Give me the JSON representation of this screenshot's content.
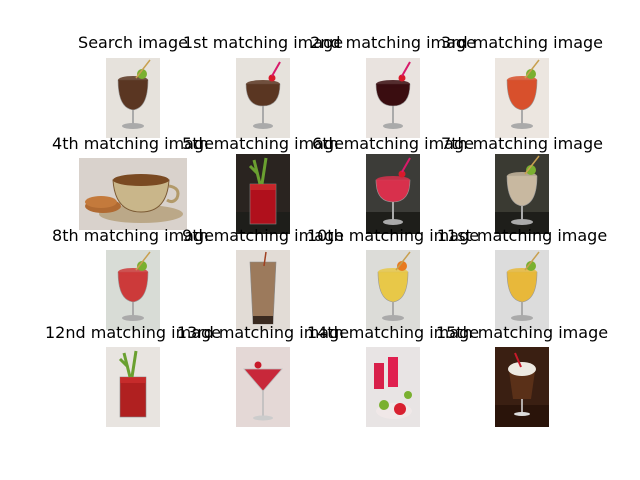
{
  "figure": {
    "captions": [
      "Search image",
      "1st matching image",
      "2nd matching image",
      "3rd matching image",
      "4th matching image",
      "5th matching image",
      "6th matching image",
      "7th matching image",
      "8th matching image",
      "9th matching image",
      "10th matching image",
      "11st matching image",
      "12nd matching image",
      "13rd matching image",
      "14th matching image",
      "15th matching image"
    ],
    "images": [
      {
        "subject": "iced tea goblet with lemon and straw",
        "bg": "#e6e2dc",
        "glass": "#5a3622"
      },
      {
        "subject": "iced tea goblet with lemon and straw",
        "bg": "#e6e2dc",
        "glass": "#5a3622"
      },
      {
        "subject": "dark red cocktail with cherry",
        "bg": "#e9e3df",
        "glass": "#3a0d10"
      },
      {
        "subject": "orange-red cocktail in stemmed glass",
        "bg": "#ece6e0",
        "glass": "#d8502c"
      },
      {
        "subject": "teacup and saucer with cookie",
        "bg": "#d9d2cc",
        "glass": "#b8a47a"
      },
      {
        "subject": "tomato juice with celery",
        "bg": "#2a2420",
        "glass": "#b0101c"
      },
      {
        "subject": "red layered cocktail with fruit",
        "bg": "#3c3c38",
        "glass": "#d8304c"
      },
      {
        "subject": "layered dessert drink",
        "bg": "#3a3a32",
        "glass": "#c8b8a0"
      },
      {
        "subject": "red cocktail with strawberry",
        "bg": "#d8dcd6",
        "glass": "#cc3a3a"
      },
      {
        "subject": "chocolate milk drink",
        "bg": "#e2dcd6",
        "glass": "#9c7a5c"
      },
      {
        "subject": "yellow cocktail with orange slice",
        "bg": "#dcdcd8",
        "glass": "#e8c848"
      },
      {
        "subject": "tropical yellow cocktail",
        "bg": "#dcdcdc",
        "glass": "#e8b83a"
      },
      {
        "subject": "red drink with celery",
        "bg": "#e8e4e0",
        "glass": "#b02020"
      },
      {
        "subject": "red martini with cherry",
        "bg": "#e4d8d6",
        "glass": "#c8283a"
      },
      {
        "subject": "pink drinks with fruit platter",
        "bg": "#e8e4e4",
        "glass": "#d8204a"
      },
      {
        "subject": "coffee drink with cream",
        "bg": "#3a1f12",
        "glass": "#eeeae2"
      }
    ]
  }
}
